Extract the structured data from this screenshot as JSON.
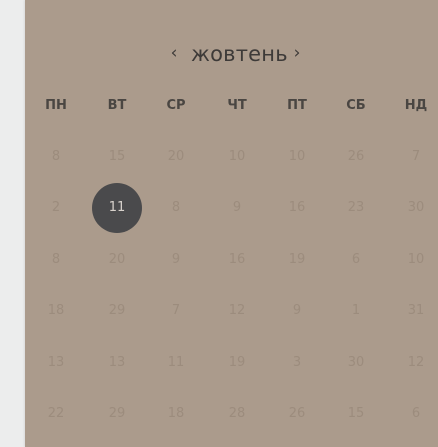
{
  "calendar": {
    "month": "жовтень",
    "prev_label": "‹",
    "next_label": "›",
    "weekdays": [
      "ПН",
      "ВТ",
      "СР",
      "ЧТ",
      "ПТ",
      "СБ",
      "НД"
    ],
    "weeks": [
      [
        "8",
        "15",
        "20",
        "10",
        "10",
        "26",
        "7"
      ],
      [
        "2",
        "11",
        "8",
        "9",
        "16",
        "23",
        "30"
      ],
      [
        "8",
        "20",
        "9",
        "16",
        "19",
        "6",
        "10"
      ],
      [
        "18",
        "29",
        "7",
        "12",
        "9",
        "1",
        "31"
      ],
      [
        "13",
        "13",
        "11",
        "19",
        "3",
        "30",
        "12"
      ],
      [
        "22",
        "29",
        "18",
        "28",
        "26",
        "15",
        "6"
      ]
    ],
    "selected": "11"
  },
  "colors": {
    "panel_background": "#ab9b8c",
    "selected_background": "#4a4a4c",
    "muted_day_text": "#9c8c7d",
    "heading_text": "#3d3a38"
  },
  "icons": {
    "prev": "chevron-left-icon",
    "next": "chevron-right-icon"
  }
}
